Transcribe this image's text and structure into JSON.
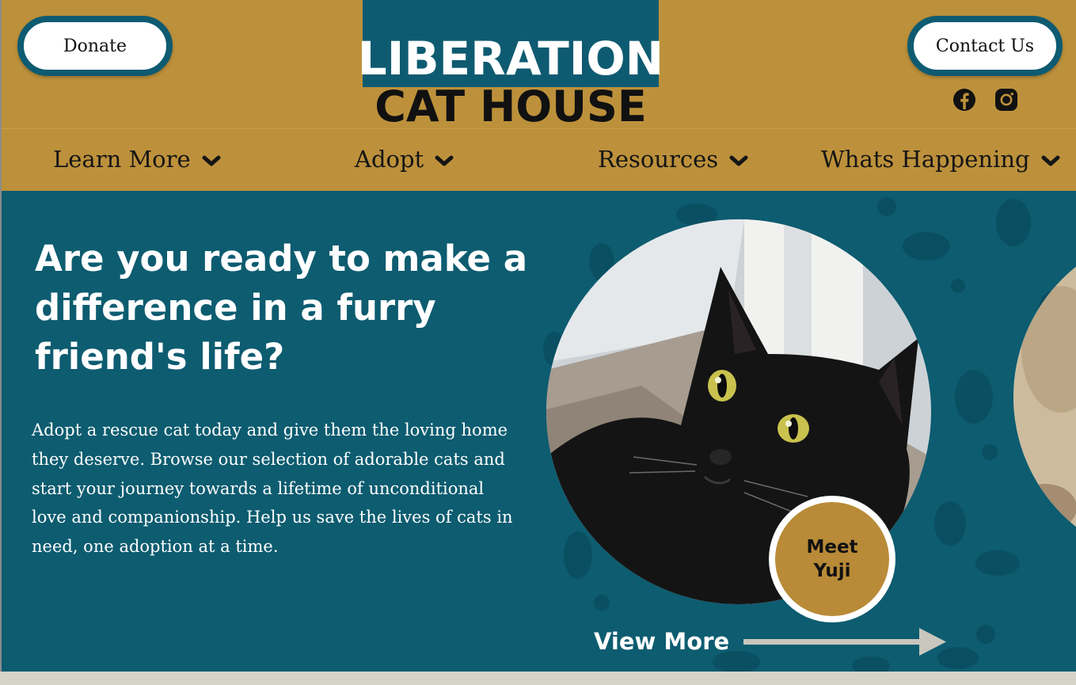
{
  "header": {
    "donate_label": "Donate",
    "contact_label": "Contact Us",
    "logo_line1": "LIBERATION",
    "logo_line2": "CAT HOUSE",
    "social": [
      "facebook-icon",
      "instagram-icon"
    ]
  },
  "nav": {
    "items": [
      {
        "label": "Learn More",
        "icon": "chevron-down-icon"
      },
      {
        "label": "Adopt",
        "icon": "chevron-down-icon"
      },
      {
        "label": "Resources",
        "icon": "chevron-down-icon"
      },
      {
        "label": "Whats Happening",
        "icon": "chevron-down-icon"
      }
    ]
  },
  "hero": {
    "title": "Are you ready to make a difference in a furry friend's life?",
    "body": "Adopt a rescue cat today and give them the loving home they deserve. Browse our selection of adorable cats and start your journey towards a lifetime of unconditional love and companionship. Help us save the lives of cats in need, one adoption at a time.",
    "featured_cat": {
      "meet_line1": "Meet",
      "meet_line2": "Yuji"
    },
    "view_more_label": "View More"
  },
  "colors": {
    "gold": "#bd913b",
    "teal": "#0d5c70",
    "badge_gold": "#b98b38",
    "white": "#ffffff"
  }
}
